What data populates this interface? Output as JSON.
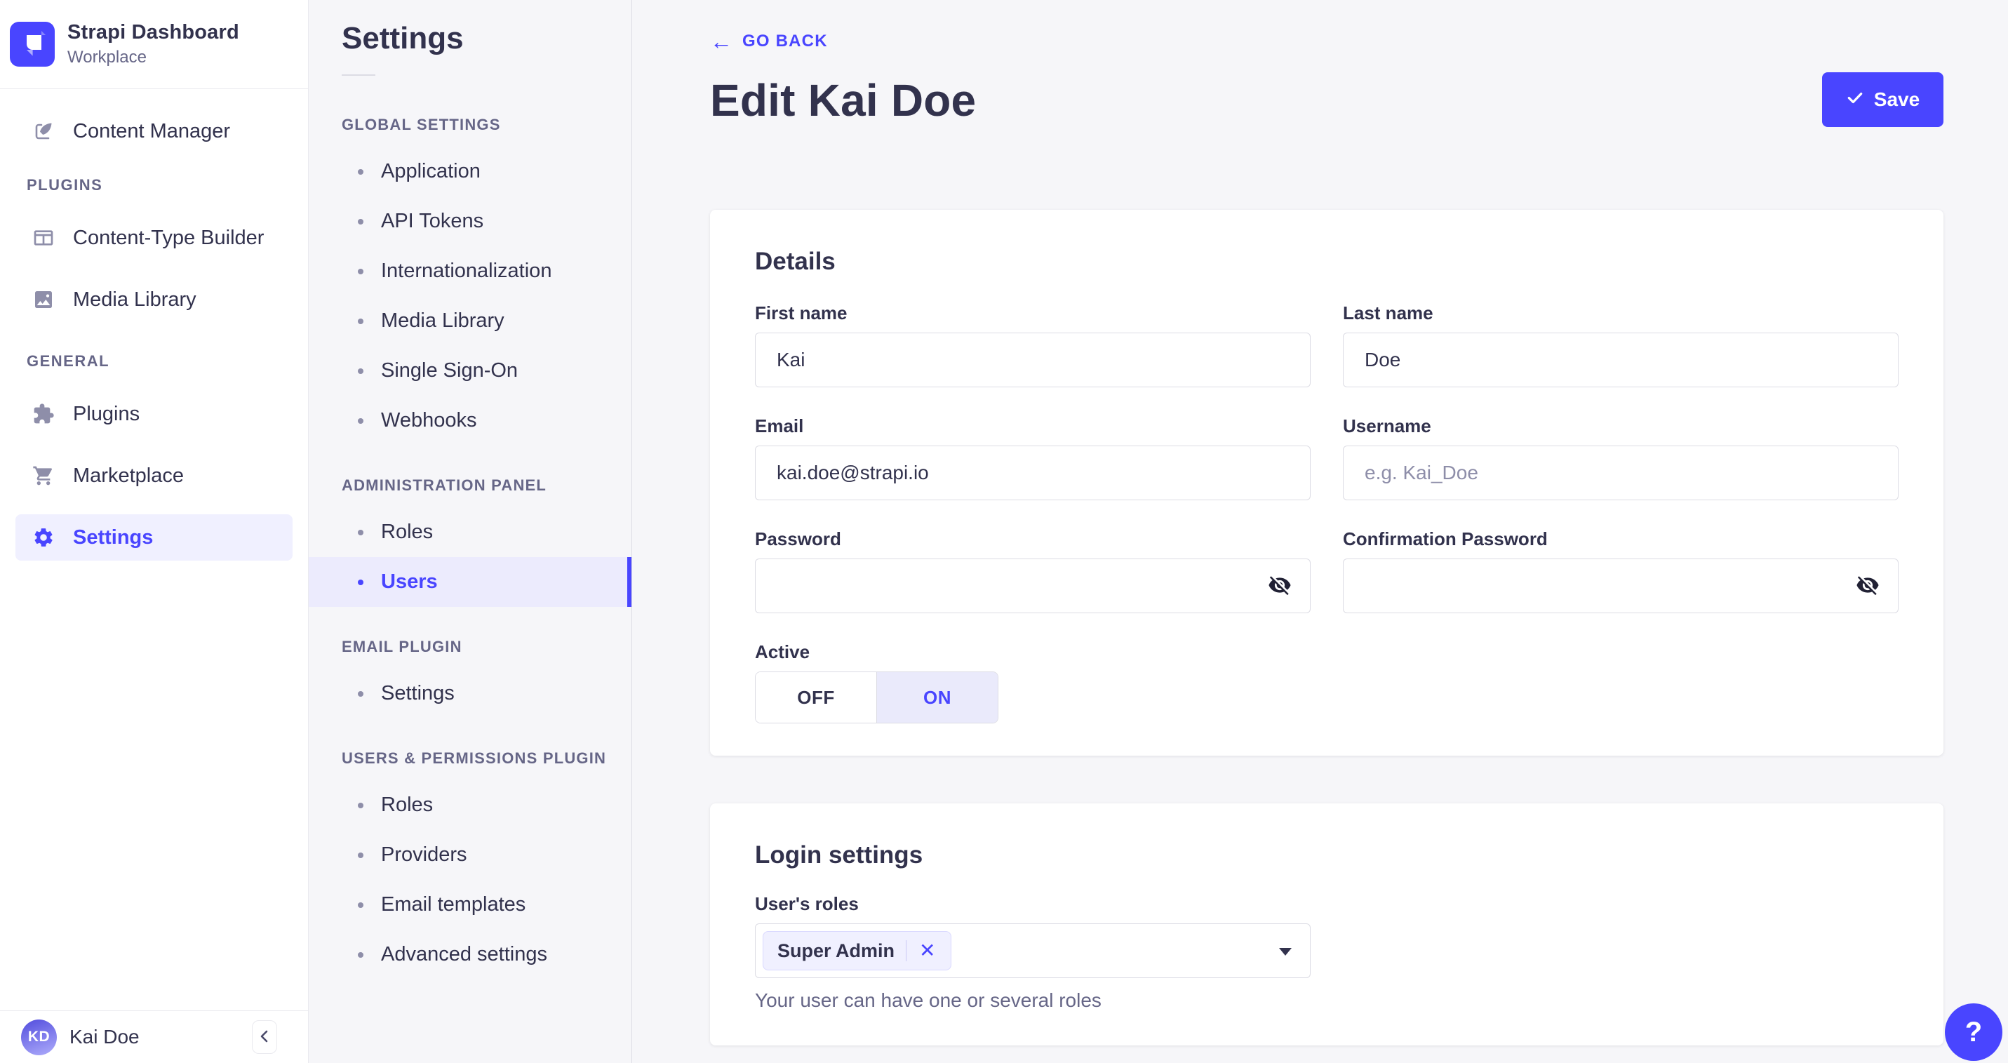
{
  "brand": {
    "name": "Strapi Dashboard",
    "workspace": "Workplace"
  },
  "nav": {
    "content_manager": {
      "label": "Content Manager",
      "icon": "feather-icon"
    },
    "sections": [
      {
        "label": "PLUGINS",
        "items": [
          {
            "label": "Content-Type Builder",
            "icon": "layout-icon"
          },
          {
            "label": "Media Library",
            "icon": "image-icon"
          }
        ]
      },
      {
        "label": "GENERAL",
        "items": [
          {
            "label": "Plugins",
            "icon": "puzzle-icon"
          },
          {
            "label": "Marketplace",
            "icon": "cart-icon"
          },
          {
            "label": "Settings",
            "icon": "gear-icon",
            "active": true
          }
        ]
      }
    ],
    "user": {
      "initials": "KD",
      "name": "Kai Doe"
    }
  },
  "subnav": {
    "title": "Settings",
    "active_item": "Users",
    "sections": [
      {
        "label": "GLOBAL SETTINGS",
        "items": [
          "Application",
          "API Tokens",
          "Internationalization",
          "Media Library",
          "Single Sign-On",
          "Webhooks"
        ]
      },
      {
        "label": "ADMINISTRATION PANEL",
        "items": [
          "Roles",
          "Users"
        ]
      },
      {
        "label": "EMAIL PLUGIN",
        "items": [
          "Settings"
        ]
      },
      {
        "label": "USERS & PERMISSIONS PLUGIN",
        "items": [
          "Roles",
          "Providers",
          "Email templates",
          "Advanced settings"
        ]
      }
    ]
  },
  "header": {
    "back_label": "GO BACK",
    "back_arrow": "←",
    "title": "Edit Kai Doe",
    "save_label": "Save"
  },
  "details": {
    "heading": "Details",
    "fields": {
      "first_name": {
        "label": "First name",
        "value": "Kai"
      },
      "last_name": {
        "label": "Last name",
        "value": "Doe"
      },
      "email": {
        "label": "Email",
        "value": "kai.doe@strapi.io"
      },
      "username": {
        "label": "Username",
        "placeholder": "e.g. Kai_Doe"
      },
      "password": {
        "label": "Password"
      },
      "confirm_password": {
        "label": "Confirmation Password"
      },
      "active": {
        "label": "Active",
        "off": "OFF",
        "on": "ON",
        "value": "ON"
      }
    }
  },
  "login_settings": {
    "heading": "Login settings",
    "roles_label": "User's roles",
    "selected_role": "Super Admin",
    "remove_role_label": "✕",
    "hint": "Your user can have one or several roles"
  },
  "help": {
    "label": "?"
  },
  "colors": {
    "primary": "#4945ff",
    "primary_light": "#f0f0ff",
    "active_row": "#ecebfd",
    "text": "#32324d",
    "text_muted": "#666687",
    "placeholder": "#8e8ea9",
    "border": "#dcdce4",
    "border_light": "#eaeaef",
    "background": "#f6f6f9",
    "surface": "#ffffff"
  }
}
